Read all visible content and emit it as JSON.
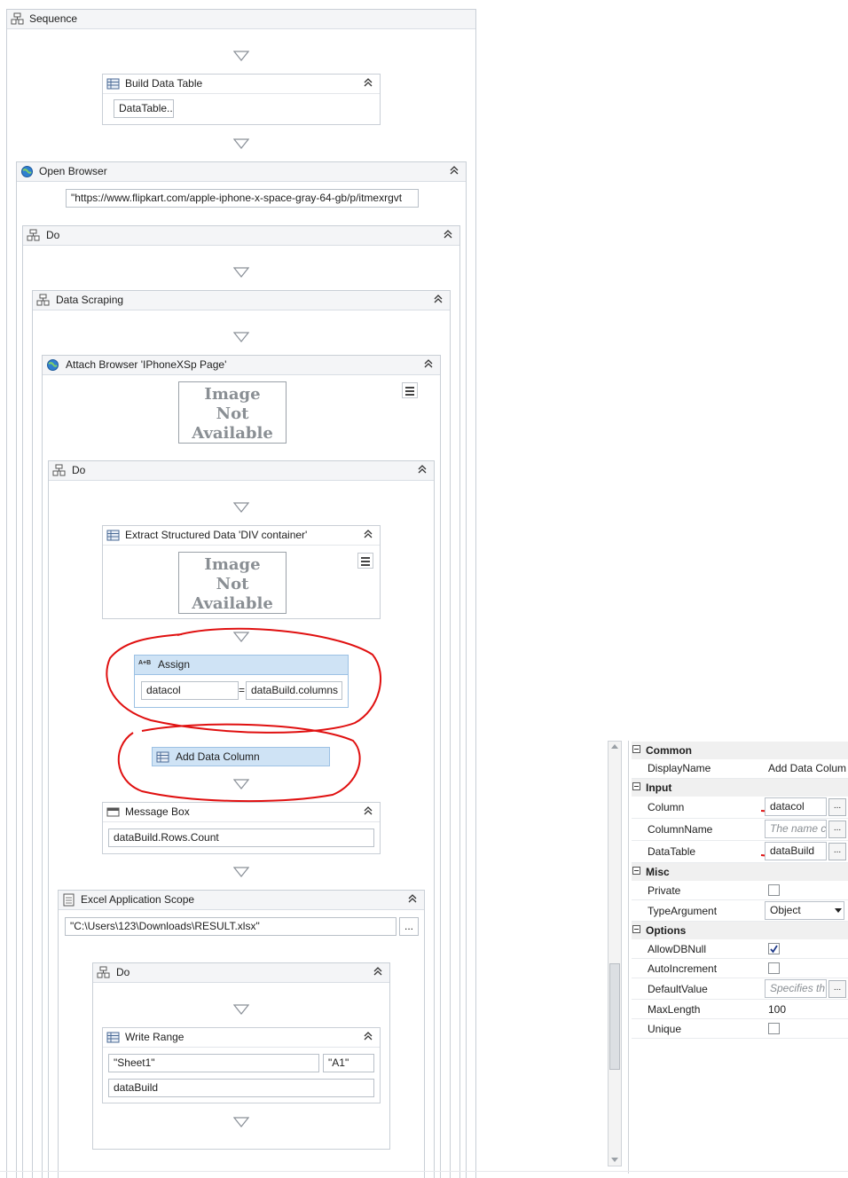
{
  "sequence": {
    "title": "Sequence"
  },
  "build_data_table": {
    "title": "Build Data Table",
    "button": "DataTable..."
  },
  "open_browser": {
    "title": "Open Browser",
    "url": "\"https://www.flipkart.com/apple-iphone-x-space-gray-64-gb/p/itmexrgvt"
  },
  "do1": {
    "title": "Do"
  },
  "data_scraping": {
    "title": "Data Scraping"
  },
  "attach_browser": {
    "title": "Attach Browser 'IPhoneXSp Page'",
    "image_na": [
      "Image",
      "Not",
      "Available"
    ]
  },
  "do2": {
    "title": "Do"
  },
  "extract": {
    "title": "Extract Structured Data 'DIV  container'",
    "image_na": [
      "Image",
      "Not",
      "Available"
    ]
  },
  "assign": {
    "title": "Assign",
    "icon_text": "A+B",
    "left": "datacol",
    "eq": "=",
    "right": "dataBuild.columns"
  },
  "add_data_column": {
    "title": "Add Data Column"
  },
  "message_box": {
    "title": "Message Box",
    "value": "dataBuild.Rows.Count"
  },
  "excel_scope": {
    "title": "Excel Application Scope",
    "path": "\"C:\\Users\\123\\Downloads\\RESULT.xlsx\"",
    "browse": "..."
  },
  "do3": {
    "title": "Do"
  },
  "write_range": {
    "title": "Write Range",
    "sheet": "\"Sheet1\"",
    "cell": "\"A1\"",
    "datatable": "dataBuild"
  },
  "properties": {
    "common": {
      "label": "Common",
      "display_name_label": "DisplayName",
      "display_name_value": "Add Data Colum"
    },
    "input": {
      "label": "Input",
      "column_label": "Column",
      "column_value": "datacol",
      "column_name_label": "ColumnName",
      "column_name_placeholder": "The name c",
      "datatable_label": "DataTable",
      "datatable_value": "dataBuild"
    },
    "misc": {
      "label": "Misc",
      "private_label": "Private",
      "type_argument_label": "TypeArgument",
      "type_argument_value": "Object"
    },
    "options": {
      "label": "Options",
      "allow_db_null_label": "AllowDBNull",
      "allow_db_null_checked": true,
      "auto_increment_label": "AutoIncrement",
      "auto_increment_checked": false,
      "default_value_label": "DefaultValue",
      "default_value_placeholder": "Specifies th",
      "max_length_label": "MaxLength",
      "max_length_value": "100",
      "unique_label": "Unique",
      "unique_checked": false
    },
    "ellipsis": "..."
  }
}
